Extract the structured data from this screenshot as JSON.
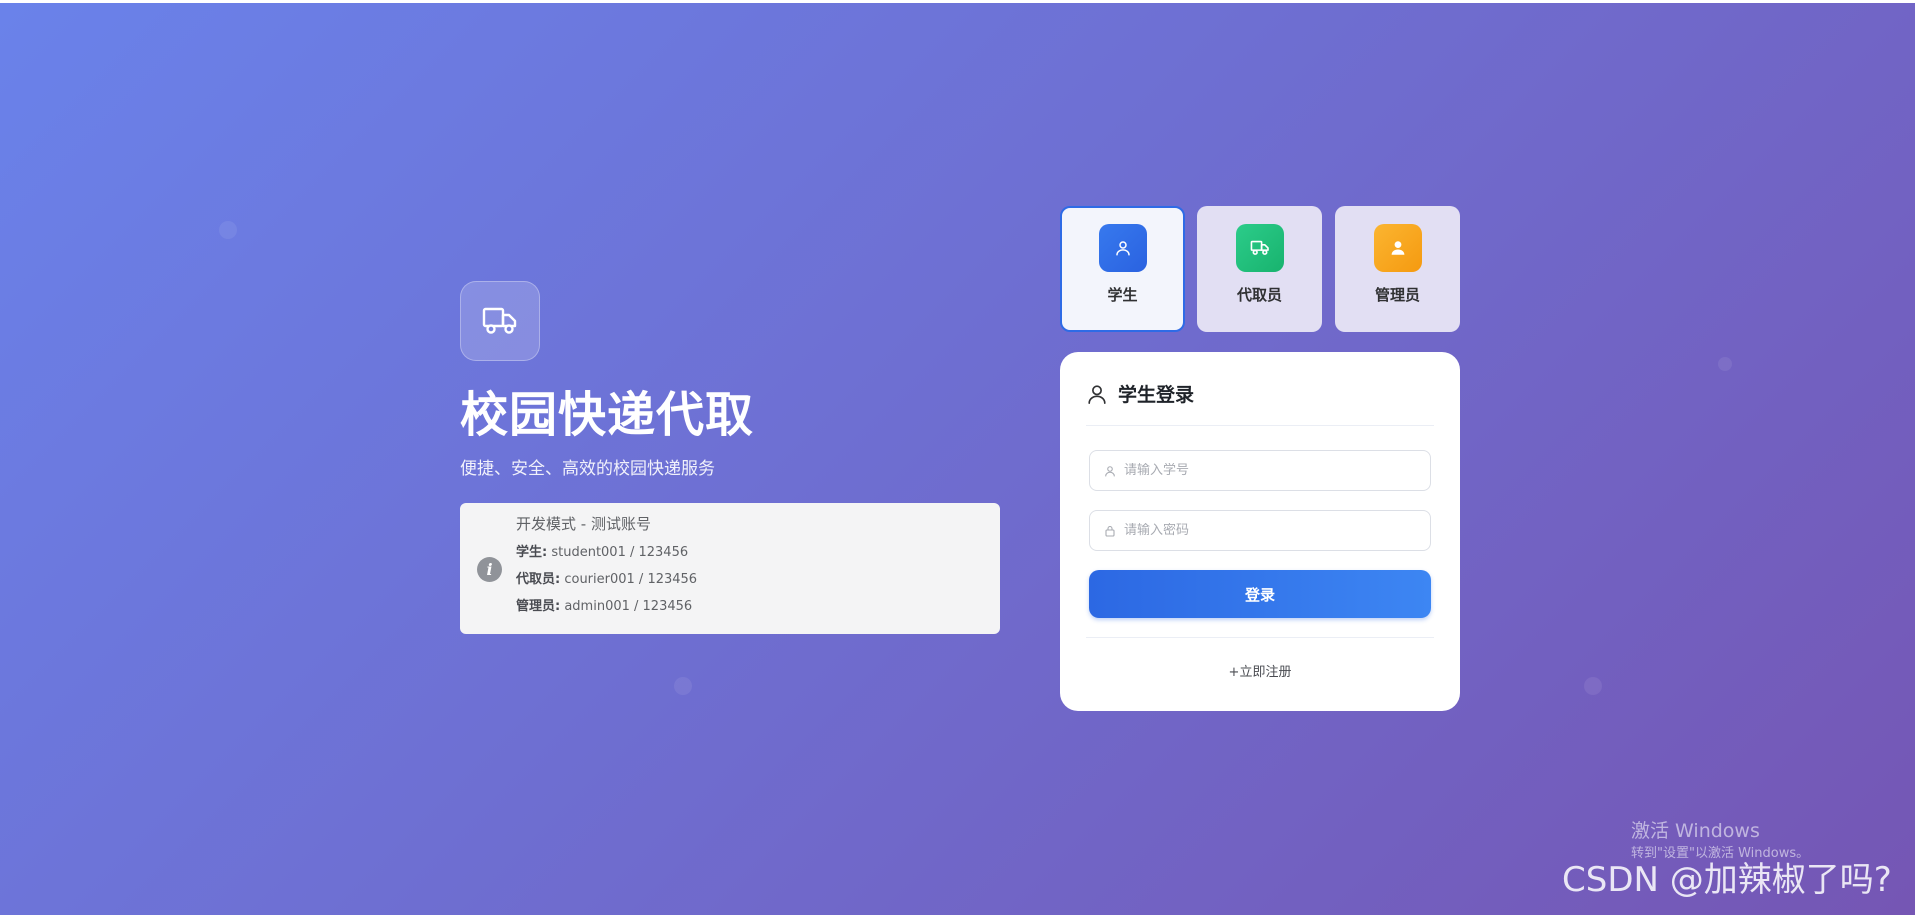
{
  "brand": {
    "logo_icon": "truck-icon",
    "title": "校园快递代取",
    "subtitle": "便捷、安全、高效的校园快递服务"
  },
  "dev_notice": {
    "icon": "info-icon",
    "title": "开发模式 - 测试账号",
    "accounts": [
      {
        "role": "学生:",
        "credentials": "student001 / 123456"
      },
      {
        "role": "代取员:",
        "credentials": "courier001 / 123456"
      },
      {
        "role": "管理员:",
        "credentials": "admin001 / 123456"
      }
    ]
  },
  "roles": [
    {
      "label": "学生",
      "icon": "user-icon",
      "color": "#2e6be6",
      "active": true
    },
    {
      "label": "代取员",
      "icon": "truck-icon",
      "color": "#20c07c",
      "active": false
    },
    {
      "label": "管理员",
      "icon": "admin-icon",
      "color": "#f7a51e",
      "active": false
    }
  ],
  "login": {
    "title": "学生登录",
    "student_id_placeholder": "请输入学号",
    "password_placeholder": "请输入密码",
    "submit_label": "登录",
    "register_label": "+立即注册"
  },
  "watermark": {
    "activate_title": "激活 Windows",
    "activate_sub": "转到\"设置\"以激活 Windows。",
    "csdn": "CSDN @加辣椒了吗?"
  }
}
